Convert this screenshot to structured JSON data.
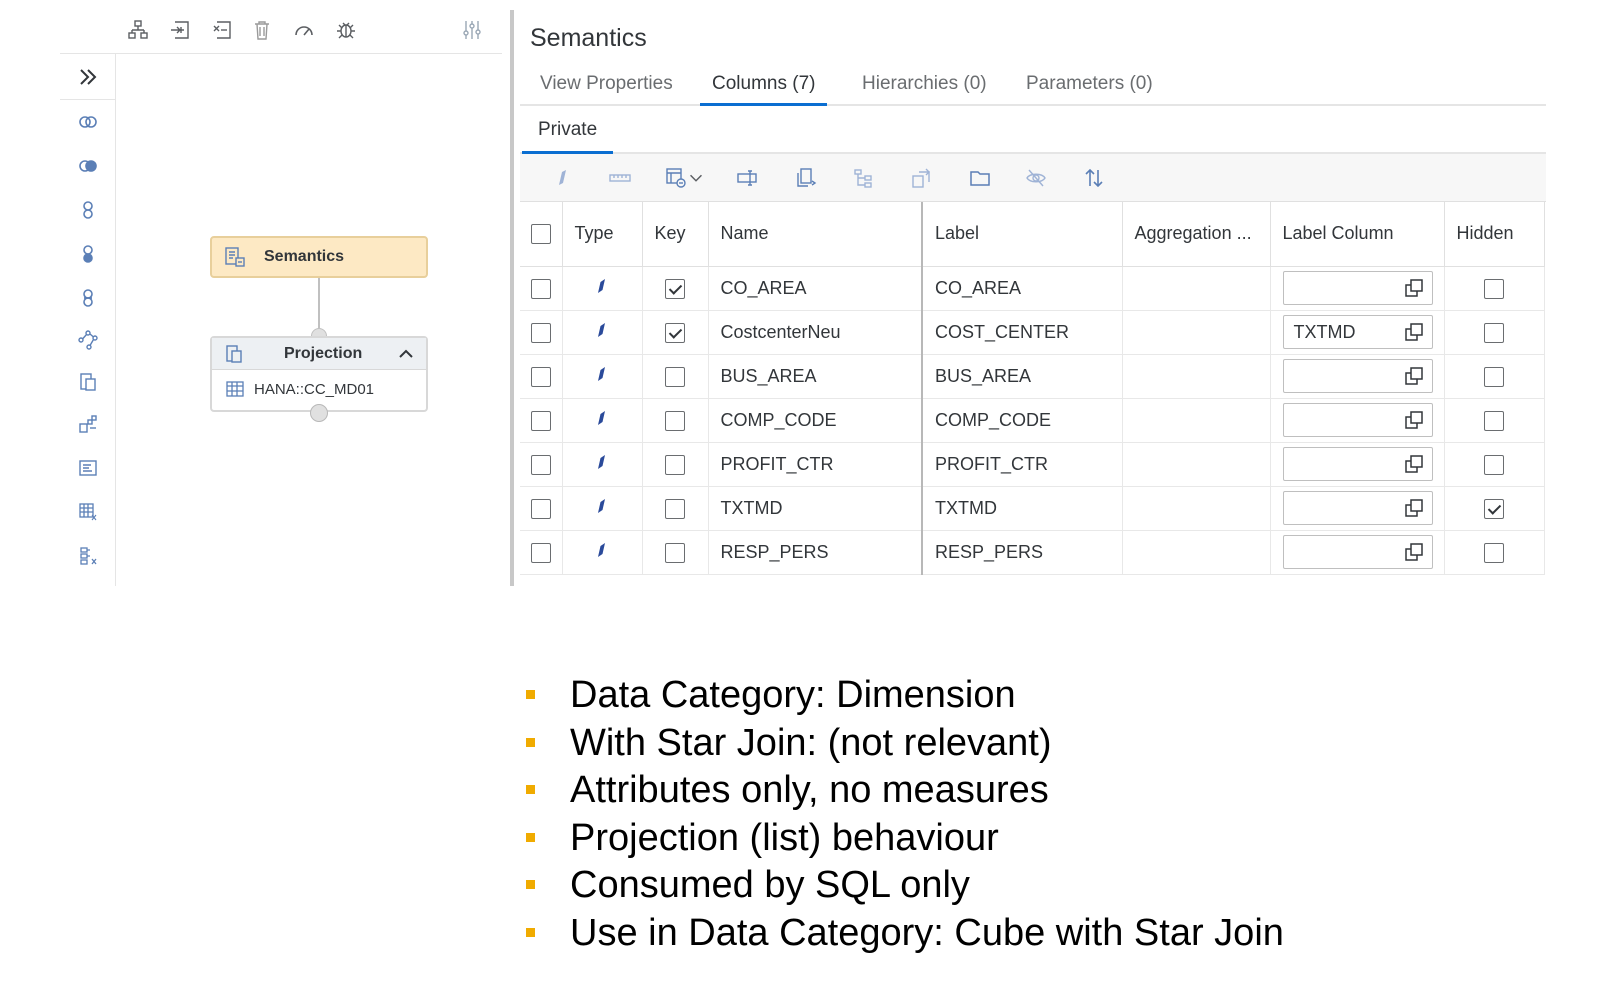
{
  "diagram": {
    "semantics_node": "Semantics",
    "projection_node": {
      "title": "Projection",
      "source": "HANA::CC_MD01"
    }
  },
  "panel": {
    "title": "Semantics",
    "tabs": [
      {
        "label": "View Properties",
        "active": false
      },
      {
        "label": "Columns (7)",
        "active": true
      },
      {
        "label": "Hierarchies (0)",
        "active": false
      },
      {
        "label": "Parameters (0)",
        "active": false
      }
    ],
    "subtab": "Private"
  },
  "grid": {
    "headers": {
      "type": "Type",
      "key": "Key",
      "name": "Name",
      "label": "Label",
      "aggregation": "Aggregation ...",
      "label_column": "Label Column",
      "hidden": "Hidden"
    },
    "rows": [
      {
        "name": "CO_AREA",
        "label": "CO_AREA",
        "label_column": "",
        "key": true,
        "hidden": false
      },
      {
        "name": "CostcenterNeu",
        "label": "COST_CENTER",
        "label_column": "TXTMD",
        "key": true,
        "hidden": false
      },
      {
        "name": "BUS_AREA",
        "label": "BUS_AREA",
        "label_column": "",
        "key": false,
        "hidden": false
      },
      {
        "name": "COMP_CODE",
        "label": "COMP_CODE",
        "label_column": "",
        "key": false,
        "hidden": false
      },
      {
        "name": "PROFIT_CTR",
        "label": "PROFIT_CTR",
        "label_column": "",
        "key": false,
        "hidden": false
      },
      {
        "name": "TXTMD",
        "label": "TXTMD",
        "label_column": "",
        "key": false,
        "hidden": true
      },
      {
        "name": "RESP_PERS",
        "label": "RESP_PERS",
        "label_column": "",
        "key": false,
        "hidden": false
      }
    ]
  },
  "bullets": [
    "Data Category: Dimension",
    "With Star Join: (not relevant)",
    "Attributes only, no measures",
    "Projection (list) behaviour",
    "Consumed by SQL only",
    "Use in Data Category: Cube with Star Join"
  ],
  "colors": {
    "accent": "#0a6ed1",
    "bullet": "#f0ab00",
    "semantics_node": "#fde9c4",
    "type_icon": "#2a4a9a"
  }
}
